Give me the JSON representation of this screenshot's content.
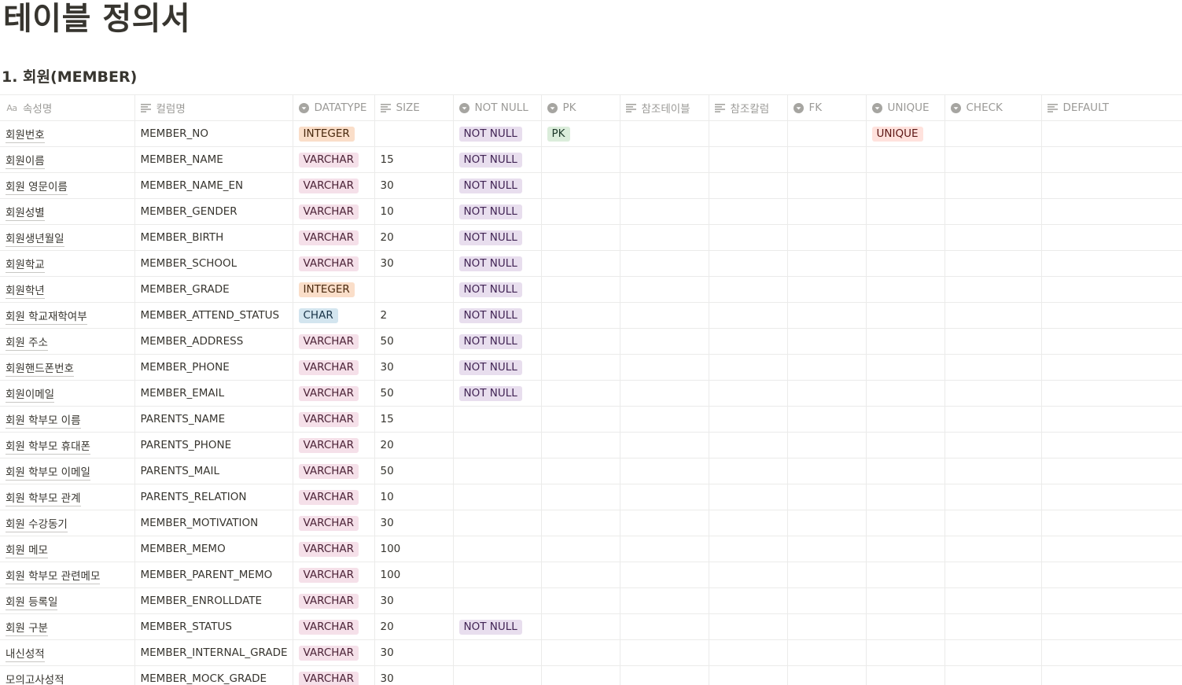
{
  "page": {
    "title": "테이블 정의서",
    "section_title": "1. 회원(MEMBER)"
  },
  "columns": [
    {
      "label": "속성명",
      "icon": "aa-icon"
    },
    {
      "label": "컬럼명",
      "icon": "text-lines-icon"
    },
    {
      "label": "DATATYPE",
      "icon": "select-icon"
    },
    {
      "label": "SIZE",
      "icon": "text-lines-icon"
    },
    {
      "label": "NOT NULL",
      "icon": "select-icon"
    },
    {
      "label": "PK",
      "icon": "select-icon"
    },
    {
      "label": "참조테이블",
      "icon": "text-lines-icon"
    },
    {
      "label": "참조칼럼",
      "icon": "text-lines-icon"
    },
    {
      "label": "FK",
      "icon": "select-icon"
    },
    {
      "label": "UNIQUE",
      "icon": "select-icon"
    },
    {
      "label": "CHECK",
      "icon": "select-icon"
    },
    {
      "label": "DEFAULT",
      "icon": "text-lines-icon"
    }
  ],
  "tag_colors": {
    "INTEGER": {
      "bg": "#fadec9",
      "fg": "#49290e"
    },
    "VARCHAR": {
      "bg": "#f5e0e9",
      "fg": "#4c2337"
    },
    "CHAR": {
      "bg": "#d3e5ef",
      "fg": "#183347"
    },
    "NOT NULL": {
      "bg": "#e8deee",
      "fg": "#412454"
    },
    "PK": {
      "bg": "#dbeddb",
      "fg": "#1c3829"
    },
    "UNIQUE": {
      "bg": "#ffe2dd",
      "fg": "#5d1715"
    }
  },
  "rows": [
    {
      "name": "회원번호",
      "column": "MEMBER_NO",
      "datatype": "INTEGER",
      "size": "",
      "not_null": "NOT NULL",
      "pk": "PK",
      "ref_table": "",
      "ref_column": "",
      "fk": "",
      "unique": "UNIQUE",
      "check": "",
      "default": ""
    },
    {
      "name": "회원이름",
      "column": "MEMBER_NAME",
      "datatype": "VARCHAR",
      "size": "15",
      "not_null": "NOT NULL",
      "pk": "",
      "ref_table": "",
      "ref_column": "",
      "fk": "",
      "unique": "",
      "check": "",
      "default": ""
    },
    {
      "name": "회원 영문이름",
      "column": "MEMBER_NAME_EN",
      "datatype": "VARCHAR",
      "size": "30",
      "not_null": "NOT NULL",
      "pk": "",
      "ref_table": "",
      "ref_column": "",
      "fk": "",
      "unique": "",
      "check": "",
      "default": ""
    },
    {
      "name": "회원성별",
      "column": "MEMBER_GENDER",
      "datatype": "VARCHAR",
      "size": "10",
      "not_null": "NOT NULL",
      "pk": "",
      "ref_table": "",
      "ref_column": "",
      "fk": "",
      "unique": "",
      "check": "",
      "default": ""
    },
    {
      "name": "회원생년월일",
      "column": "MEMBER_BIRTH",
      "datatype": "VARCHAR",
      "size": "20",
      "not_null": "NOT NULL",
      "pk": "",
      "ref_table": "",
      "ref_column": "",
      "fk": "",
      "unique": "",
      "check": "",
      "default": ""
    },
    {
      "name": "회원학교",
      "column": "MEMBER_SCHOOL",
      "datatype": "VARCHAR",
      "size": "30",
      "not_null": "NOT NULL",
      "pk": "",
      "ref_table": "",
      "ref_column": "",
      "fk": "",
      "unique": "",
      "check": "",
      "default": ""
    },
    {
      "name": "회원학년",
      "column": "MEMBER_GRADE",
      "datatype": "INTEGER",
      "size": "",
      "not_null": "NOT NULL",
      "pk": "",
      "ref_table": "",
      "ref_column": "",
      "fk": "",
      "unique": "",
      "check": "",
      "default": ""
    },
    {
      "name": "회원 학교재학여부",
      "column": "MEMBER_ATTEND_STATUS",
      "datatype": "CHAR",
      "size": "2",
      "not_null": "NOT NULL",
      "pk": "",
      "ref_table": "",
      "ref_column": "",
      "fk": "",
      "unique": "",
      "check": "",
      "default": ""
    },
    {
      "name": "회원 주소",
      "column": "MEMBER_ADDRESS",
      "datatype": "VARCHAR",
      "size": "50",
      "not_null": "NOT NULL",
      "pk": "",
      "ref_table": "",
      "ref_column": "",
      "fk": "",
      "unique": "",
      "check": "",
      "default": ""
    },
    {
      "name": "회원핸드폰번호",
      "column": "MEMBER_PHONE",
      "datatype": "VARCHAR",
      "size": "30",
      "not_null": "NOT NULL",
      "pk": "",
      "ref_table": "",
      "ref_column": "",
      "fk": "",
      "unique": "",
      "check": "",
      "default": ""
    },
    {
      "name": "회원이메일",
      "column": "MEMBER_EMAIL",
      "datatype": "VARCHAR",
      "size": "50",
      "not_null": "NOT NULL",
      "pk": "",
      "ref_table": "",
      "ref_column": "",
      "fk": "",
      "unique": "",
      "check": "",
      "default": ""
    },
    {
      "name": "회원 학부모 이름",
      "column": "PARENTS_NAME",
      "datatype": "VARCHAR",
      "size": "15",
      "not_null": "",
      "pk": "",
      "ref_table": "",
      "ref_column": "",
      "fk": "",
      "unique": "",
      "check": "",
      "default": ""
    },
    {
      "name": "회원 학부모 휴대폰",
      "column": "PARENTS_PHONE",
      "datatype": "VARCHAR",
      "size": "20",
      "not_null": "",
      "pk": "",
      "ref_table": "",
      "ref_column": "",
      "fk": "",
      "unique": "",
      "check": "",
      "default": ""
    },
    {
      "name": "회원 학부모 이메일",
      "column": "PARENTS_MAIL",
      "datatype": "VARCHAR",
      "size": "50",
      "not_null": "",
      "pk": "",
      "ref_table": "",
      "ref_column": "",
      "fk": "",
      "unique": "",
      "check": "",
      "default": ""
    },
    {
      "name": "회원 학부모 관계",
      "column": "PARENTS_RELATION",
      "datatype": "VARCHAR",
      "size": "10",
      "not_null": "",
      "pk": "",
      "ref_table": "",
      "ref_column": "",
      "fk": "",
      "unique": "",
      "check": "",
      "default": ""
    },
    {
      "name": "회원 수강동기",
      "column": "MEMBER_MOTIVATION",
      "datatype": "VARCHAR",
      "size": "30",
      "not_null": "",
      "pk": "",
      "ref_table": "",
      "ref_column": "",
      "fk": "",
      "unique": "",
      "check": "",
      "default": ""
    },
    {
      "name": "회원 메모",
      "column": "MEMBER_MEMO",
      "datatype": "VARCHAR",
      "size": "100",
      "not_null": "",
      "pk": "",
      "ref_table": "",
      "ref_column": "",
      "fk": "",
      "unique": "",
      "check": "",
      "default": ""
    },
    {
      "name": "회원 학부모 관련메모",
      "column": "MEMBER_PARENT_MEMO",
      "datatype": "VARCHAR",
      "size": "100",
      "not_null": "",
      "pk": "",
      "ref_table": "",
      "ref_column": "",
      "fk": "",
      "unique": "",
      "check": "",
      "default": ""
    },
    {
      "name": "회원 등록일",
      "column": "MEMBER_ENROLLDATE",
      "datatype": "VARCHAR",
      "size": "30",
      "not_null": "",
      "pk": "",
      "ref_table": "",
      "ref_column": "",
      "fk": "",
      "unique": "",
      "check": "",
      "default": ""
    },
    {
      "name": "회원 구분",
      "column": "MEMBER_STATUS",
      "datatype": "VARCHAR",
      "size": "20",
      "not_null": "NOT NULL",
      "pk": "",
      "ref_table": "",
      "ref_column": "",
      "fk": "",
      "unique": "",
      "check": "",
      "default": ""
    },
    {
      "name": "내신성적",
      "column": "MEMBER_INTERNAL_GRADE",
      "datatype": "VARCHAR",
      "size": "30",
      "not_null": "",
      "pk": "",
      "ref_table": "",
      "ref_column": "",
      "fk": "",
      "unique": "",
      "check": "",
      "default": ""
    },
    {
      "name": "모의고사성적",
      "column": "MEMBER_MOCK_GRADE",
      "datatype": "VARCHAR",
      "size": "30",
      "not_null": "",
      "pk": "",
      "ref_table": "",
      "ref_column": "",
      "fk": "",
      "unique": "",
      "check": "",
      "default": ""
    }
  ]
}
